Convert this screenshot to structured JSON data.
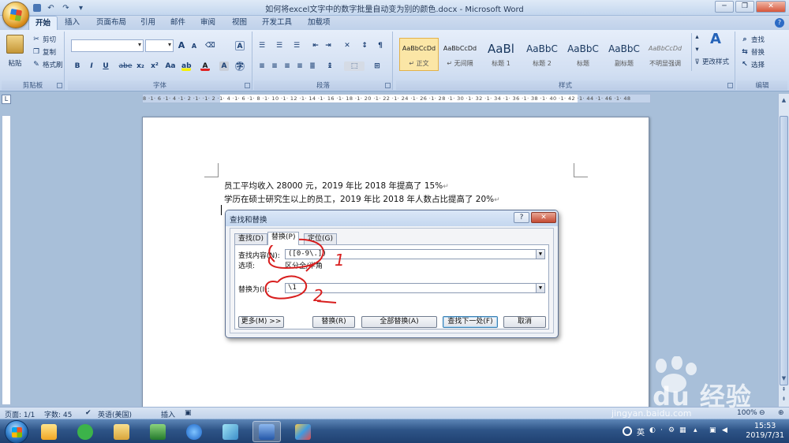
{
  "window": {
    "title": "如何将excel文字中的数字批量自动变为别的颜色.docx - Microsoft Word",
    "controls": [
      "─",
      "❐",
      "✕"
    ]
  },
  "quick_access": [
    "save-icon",
    "undo-icon",
    "redo-icon",
    "customize-icon"
  ],
  "tabs": [
    "开始",
    "插入",
    "页面布局",
    "引用",
    "邮件",
    "审阅",
    "视图",
    "开发工具",
    "加载项"
  ],
  "ribbon": {
    "clipboard": {
      "label": "剪贴板",
      "paste": "粘贴",
      "cut": "剪切",
      "copy": "复制",
      "format_painter": "格式刷"
    },
    "font": {
      "label": "字体",
      "bold": "B",
      "italic": "I",
      "underline": "U",
      "strike": "abe",
      "sub": "x₂",
      "sup": "x²",
      "aa": "Aa",
      "grow": "A",
      "shrink": "A"
    },
    "paragraph": {
      "label": "段落"
    },
    "styles": {
      "label": "样式",
      "items": [
        {
          "preview": "AaBbCcDd",
          "name": "↵ 正文",
          "size": "small",
          "selected": true
        },
        {
          "preview": "AaBbCcDd",
          "name": "↵ 无间隔",
          "size": "small"
        },
        {
          "preview": "AaBl",
          "name": "标题 1",
          "size": "big"
        },
        {
          "preview": "AaBbC",
          "name": "标题 2",
          "size": "mid"
        },
        {
          "preview": "AaBbC",
          "name": "标题",
          "size": "mid"
        },
        {
          "preview": "AaBbC",
          "name": "副标题",
          "size": "mid"
        },
        {
          "preview": "AaBbCcDd",
          "name": "不明显强调",
          "size": "small"
        }
      ],
      "change_styles": "更改样式"
    },
    "editing": {
      "label": "编辑",
      "find": "查找",
      "replace": "替换",
      "select": "选择"
    }
  },
  "ruler": {
    "text": "8 ·1· 6 ·1· 4 ·1· 2 ·1·  ·1· 2 ·1· 4 ·1· 6 ·1· 8 ·1· 10 ·1· 12 ·1· 14 ·1· 16 ·1· 18 ·1· 20 ·1· 22 ·1· 24 ·1· 26 ·1· 28 ·1· 30 ·1· 32 ·1· 34 ·1· 36 ·1· 38 ·1· 40 ·1· 42 ·1· 44 ·1· 46 ·1· 48"
  },
  "document": {
    "lines": [
      "员工平均收入 28000 元，2019 年比 2018 年提高了 15%",
      "学历在硕士研究生以上的员工，2019 年比 2018 年人数占比提高了 20%"
    ],
    "pilcrow": "↵"
  },
  "dialog": {
    "title": "查找和替换",
    "help": "?",
    "close": "✕",
    "tabs": [
      "查找(D)",
      "替换(P)",
      "定位(G)"
    ],
    "active_tab": "替换(P)",
    "find_label": "查找内容(N):",
    "find_value": "([0-9\\.])",
    "options_label": "选项:",
    "options_value": "区分全/半角",
    "replace_label": "替换为(I):",
    "replace_value": "\\1",
    "buttons": {
      "more": "更多(M) >>",
      "replace": "替换(R)",
      "replace_all": "全部替换(A)",
      "find_next": "查找下一处(F)",
      "cancel": "取消"
    },
    "annotations": [
      "1",
      "2"
    ]
  },
  "statusbar": {
    "page": "页面: 1/1",
    "words": "字数: 45",
    "language": "英语(美国)",
    "mode": "插入",
    "zoom": "100%"
  },
  "taskbar": {
    "apps": [
      "qq-icon",
      "wechat-icon",
      "file-explorer-icon",
      "excel-icon",
      "sogou-icon",
      "app-icon",
      "word-icon",
      "paint-icon"
    ],
    "tray_lang": "英",
    "time": "15:53",
    "date": "2019/7/31"
  },
  "watermark": {
    "logo": "Bai du 经验",
    "url": "jingyan.baidu.com"
  }
}
